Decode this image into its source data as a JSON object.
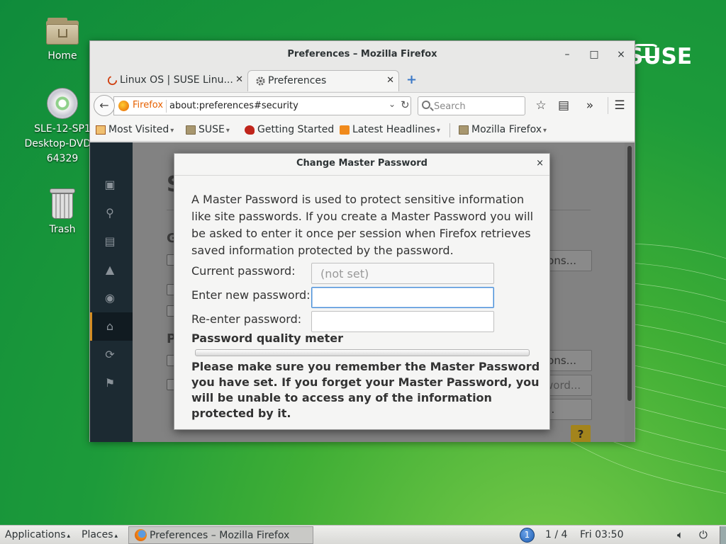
{
  "desktop": {
    "icons": [
      {
        "label": "Home"
      },
      {
        "label_lines": [
          "SLE-12-SP1",
          "Desktop-DVD-x",
          "64329"
        ]
      },
      {
        "label": "Trash"
      }
    ],
    "brand": "SUSE"
  },
  "window": {
    "title": "Preferences – Mozilla Firefox",
    "controls": {
      "minimize": "–",
      "maximize": "□",
      "close": "×"
    },
    "tabs": [
      {
        "label": "Linux OS | SUSE Linu...",
        "active": false
      },
      {
        "label": "Preferences",
        "active": true
      }
    ],
    "new_tab": "+",
    "nav": {
      "back": "←",
      "identity": "Firefox",
      "url": "about:preferences#security",
      "search_placeholder": "Search"
    },
    "bookmarks": [
      {
        "label": "Most Visited",
        "icon": "most-visited-icon"
      },
      {
        "label": "SUSE",
        "icon": "folder-icon"
      },
      {
        "label": "Getting Started",
        "icon": "chameleon-icon"
      },
      {
        "label": "Latest Headlines",
        "icon": "rss-icon"
      },
      {
        "label": "Mozilla Firefox",
        "icon": "folder-icon"
      }
    ]
  },
  "pref_sidebar_icons": [
    "general-icon",
    "search-icon",
    "content-icon",
    "applications-icon",
    "privacy-icon",
    "security-icon",
    "sync-icon",
    "advanced-icon"
  ],
  "background_fragments": {
    "heading": "S",
    "g": "G",
    "p": "P",
    "btn1": "ions...",
    "btn2": "ions...",
    "btn3": "word...",
    "btn4": "...",
    "help": "?"
  },
  "dialog": {
    "title": "Change Master Password",
    "close": "×",
    "description": "A Master Password is used to protect sensitive information like site passwords. If you create a Master Password you will be asked to enter it once per session when Firefox retrieves saved information protected by the password.",
    "current_label": "Current password:",
    "current_placeholder": "(not set)",
    "new_label": "Enter new password:",
    "new_value": "",
    "reenter_label": "Re-enter password:",
    "reenter_value": "",
    "quality_label": "Password quality meter",
    "quality_value": 0,
    "warning": "Please make sure you remember the Master Password you have set. If you forget your Master Password, you will be unable to access any of the information protected by it."
  },
  "taskbar": {
    "applications": "Applications",
    "places": "Places",
    "task": "Preferences – Mozilla Firefox",
    "workspace_badge": "1",
    "workspace": "1 / 4",
    "clock": "Fri 03:50",
    "volume_icon": "volume-icon",
    "power_icon": "power-icon"
  },
  "colors": {
    "desktop_green": "#1d9b3a",
    "accent_orange": "#e66000",
    "focus_blue": "#4a90d9",
    "sidebar_dark": "#1c2a32",
    "sidebar_active_marker": "#d28c20"
  }
}
